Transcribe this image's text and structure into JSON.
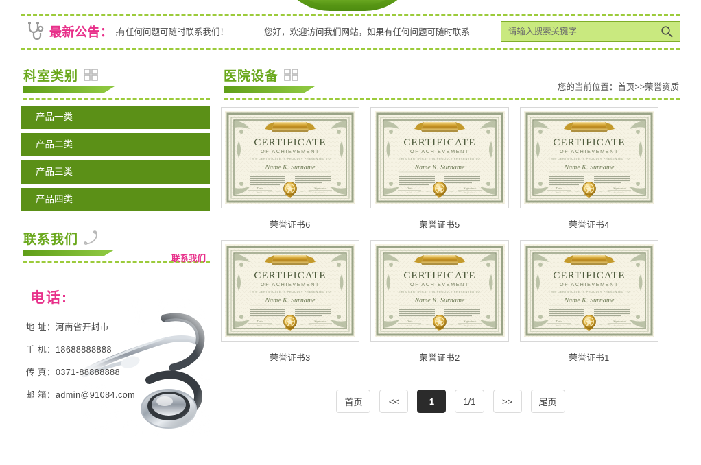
{
  "notice": {
    "icon": "stethoscope-icon",
    "title": "最新公告：",
    "messages": [
      "]网站，如果有任何问题可随时联系我们！",
      "您好，欢迎访问我们网站，如果有任何问题可随时联系"
    ]
  },
  "search": {
    "placeholder": "请输入搜索关键字",
    "value": "",
    "button_icon": "search-icon"
  },
  "sidebar": {
    "category": {
      "title": "科室类别",
      "icon": "four-squares-icon"
    },
    "menu": [
      {
        "label": "产品一类"
      },
      {
        "label": "产品二类"
      },
      {
        "label": "产品三类"
      },
      {
        "label": "产品四类"
      }
    ],
    "contact": {
      "title": "联系我们",
      "icon": "phone-handset-icon",
      "link_label": "联系我们",
      "tel_heading": "电话:",
      "lines": [
        "地 址：河南省开封市",
        "手 机：18688888888",
        "传 真：0371-88888888",
        "邮 箱：admin@91084.com"
      ]
    }
  },
  "main": {
    "title": "医院设备",
    "icon": "four-squares-icon",
    "breadcrumb": "您的当前位置：首页>>荣誉资质",
    "certificate_text": {
      "heading": "CERTIFICATE",
      "subheading": "OF ACHIEVEMENT",
      "presented_to": "THIS CERTIFICATE IS PROUDLY PRESENTED TO",
      "name": "Name K. Surname",
      "left_signature": "Date",
      "right_signature": "Signature"
    },
    "items": [
      {
        "label": "荣誉证书6"
      },
      {
        "label": "荣誉证书5"
      },
      {
        "label": "荣誉证书4"
      },
      {
        "label": "荣誉证书3"
      },
      {
        "label": "荣誉证书2"
      },
      {
        "label": "荣誉证书1"
      }
    ]
  },
  "pagination": {
    "first": "首页",
    "prev": "<<",
    "current": "1",
    "indicator": "1/1",
    "next": ">>",
    "last": "尾页"
  },
  "colors": {
    "brand_green": "#6aa81c",
    "menu_green": "#5b9017",
    "accent_pink": "#e8308a",
    "search_bg": "#c9e97f",
    "dash_green": "#9ccb3b",
    "active_page": "#2b2b2b"
  }
}
